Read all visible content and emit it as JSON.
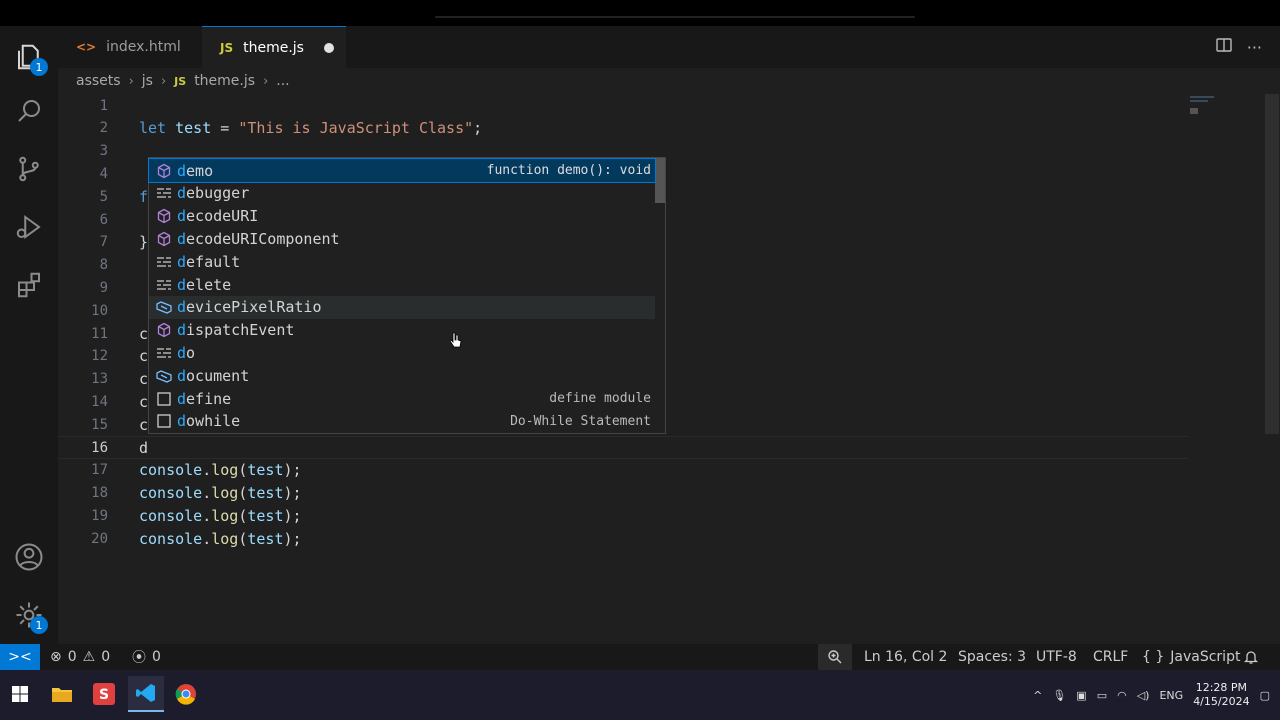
{
  "tabs": [
    {
      "label": "index.html",
      "icon": "html-brackets-icon"
    },
    {
      "label": "theme.js",
      "icon": "JS",
      "modified": true
    }
  ],
  "breadcrumb": {
    "parts": [
      "assets",
      "js",
      "theme.js",
      "..."
    ],
    "js_icon": "JS"
  },
  "editor": {
    "lines": [
      {
        "n": "1",
        "t": ""
      },
      {
        "n": "2",
        "t": "let test = \"This is JavaScript Class\";"
      },
      {
        "n": "3",
        "t": ""
      },
      {
        "n": "4",
        "t": ""
      },
      {
        "n": "5",
        "t": "f"
      },
      {
        "n": "6",
        "t": ""
      },
      {
        "n": "7",
        "t": "}"
      },
      {
        "n": "8",
        "t": ""
      },
      {
        "n": "9",
        "t": ""
      },
      {
        "n": "10",
        "t": ""
      },
      {
        "n": "11",
        "t": "c"
      },
      {
        "n": "12",
        "t": "c"
      },
      {
        "n": "13",
        "t": "c"
      },
      {
        "n": "14",
        "t": "c"
      },
      {
        "n": "15",
        "t": "c"
      },
      {
        "n": "16",
        "t": "d"
      },
      {
        "n": "17",
        "t": "console.log(test);"
      },
      {
        "n": "18",
        "t": "console.log(test);"
      },
      {
        "n": "19",
        "t": "console.log(test);"
      },
      {
        "n": "20",
        "t": "console.log(test);"
      }
    ],
    "current_line": "16"
  },
  "suggestions": [
    {
      "label": "demo",
      "kind": "method",
      "detail": "function demo(): void",
      "selected": true
    },
    {
      "label": "debugger",
      "kind": "keyword",
      "detail": ""
    },
    {
      "label": "decodeURI",
      "kind": "method",
      "detail": ""
    },
    {
      "label": "decodeURIComponent",
      "kind": "method",
      "detail": ""
    },
    {
      "label": "default",
      "kind": "keyword",
      "detail": ""
    },
    {
      "label": "delete",
      "kind": "keyword",
      "detail": ""
    },
    {
      "label": "devicePixelRatio",
      "kind": "variable",
      "detail": "",
      "hovered": true
    },
    {
      "label": "dispatchEvent",
      "kind": "method",
      "detail": ""
    },
    {
      "label": "do",
      "kind": "keyword",
      "detail": ""
    },
    {
      "label": "document",
      "kind": "variable",
      "detail": ""
    },
    {
      "label": "define",
      "kind": "snippet",
      "detail": "define module"
    },
    {
      "label": "dowhile",
      "kind": "snippet",
      "detail": "Do-While Statement"
    }
  ],
  "activity_bar": {
    "explorer_badge": "1",
    "settings_badge": "1"
  },
  "status": {
    "errors": "0",
    "warnings": "0",
    "ports": "0",
    "position": "Ln 16, Col 2",
    "spaces": "Spaces: 3",
    "encoding": "UTF-8",
    "eol": "CRLF",
    "language": "JavaScript"
  },
  "taskbar": {
    "lang": "ENG",
    "time": "12:28 PM",
    "date": "4/15/2024"
  },
  "colors": {
    "accent": "#0078d4",
    "editor_bg": "#1f1f1f",
    "sidebar_bg": "#181818"
  }
}
